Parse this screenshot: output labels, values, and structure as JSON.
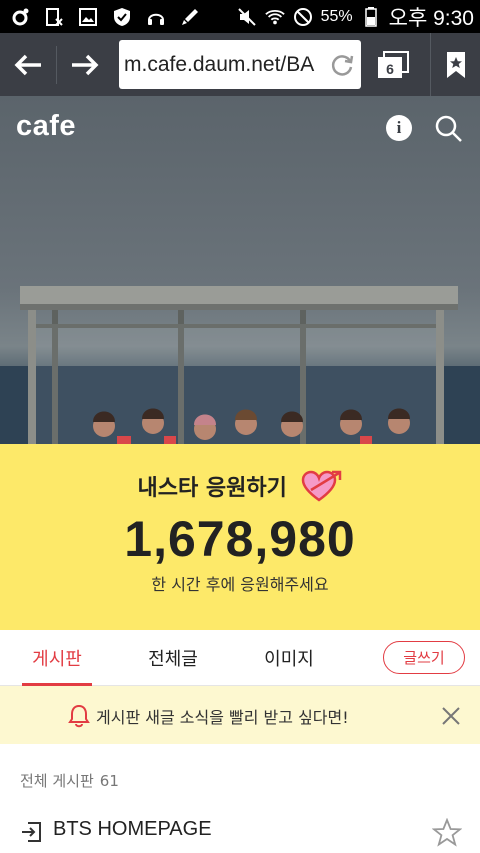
{
  "status_bar": {
    "battery_percent": "55%",
    "time": "오후 9:30",
    "icons": [
      "circle-icon",
      "sim-x-icon",
      "image-icon",
      "shield-icon",
      "headset-icon",
      "brush-icon",
      "mute-icon",
      "wifi-icon",
      "do-not-disturb-icon",
      "battery-icon"
    ]
  },
  "browser": {
    "url": "m.cafe.daum.net/BA",
    "tab_count": "6"
  },
  "hero": {
    "logo": "cafe",
    "info_label": "i"
  },
  "banner": {
    "title": "내스타 응원하기",
    "count": "1,678,980",
    "subtitle": "한 시간 후에 응원해주세요",
    "bg_color": "#fde969"
  },
  "tabs": {
    "items": [
      {
        "label": "게시판",
        "active": true
      },
      {
        "label": "전체글",
        "active": false
      },
      {
        "label": "이미지",
        "active": false
      }
    ],
    "write_label": "글쓰기",
    "accent_color": "#e23c43"
  },
  "notice": {
    "text": "게시판 새글 소식을 빨리 받고 싶다면!"
  },
  "board": {
    "header_label": "전체 게시판",
    "header_count": "61",
    "items": [
      {
        "title": "BTS HOMEPAGE"
      }
    ]
  }
}
